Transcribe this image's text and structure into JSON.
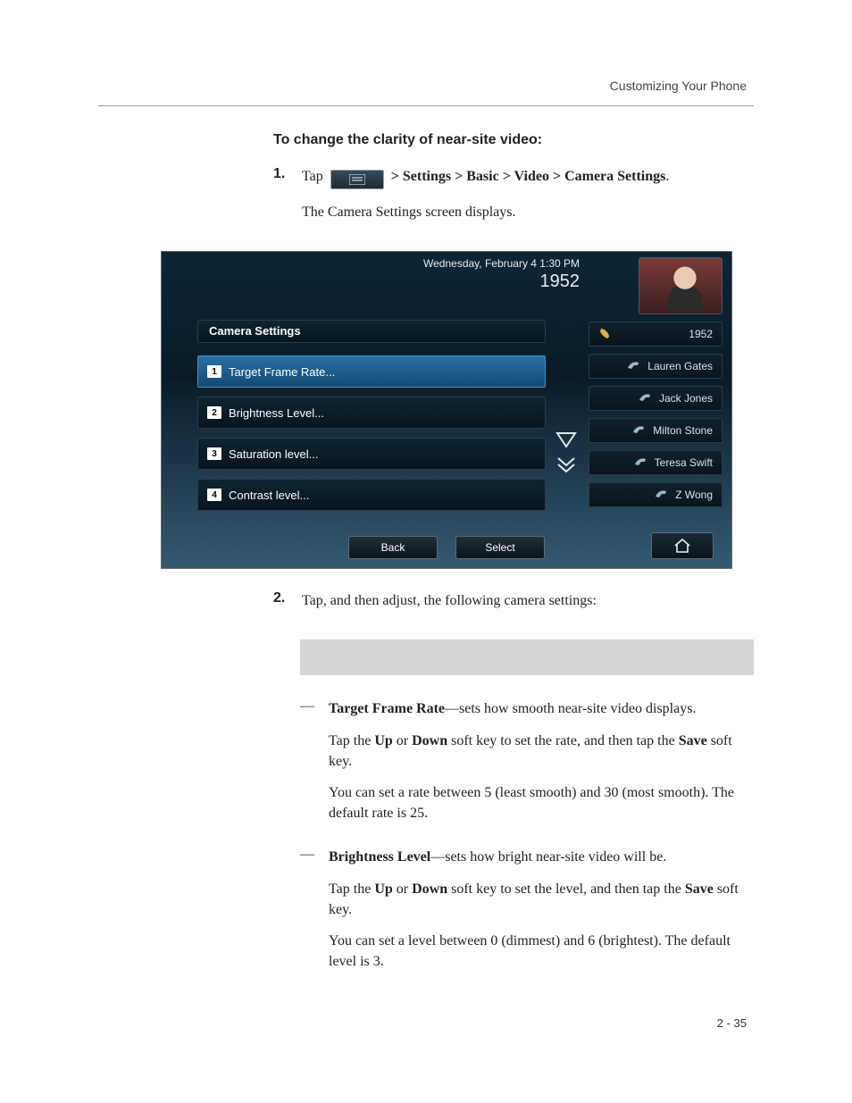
{
  "running_header": "Customizing Your Phone",
  "heading": "To change the clarity of near-site video:",
  "steps": {
    "s1": {
      "num": "1.",
      "lead": "Tap",
      "trail_prefix": " > ",
      "path1": "Settings",
      "path2": "Basic",
      "path3": "Video",
      "path4": "Camera Settings",
      "follow": "The Camera Settings screen displays."
    },
    "s2": {
      "num": "2.",
      "text": "Tap, and then adjust, the following camera settings:"
    }
  },
  "device": {
    "date": "Wednesday, February 4  1:30 PM",
    "extension": "1952",
    "title": "Camera Settings",
    "items": [
      {
        "n": "1",
        "label": "Target Frame Rate..."
      },
      {
        "n": "2",
        "label": "Brightness Level..."
      },
      {
        "n": "3",
        "label": "Saturation level..."
      },
      {
        "n": "4",
        "label": "Contrast level..."
      }
    ],
    "side": {
      "ext": "1952",
      "contacts": [
        "Lauren Gates",
        "Jack Jones",
        "Milton Stone",
        "Teresa Swift",
        "Z Wong"
      ]
    },
    "softkeys": {
      "back": "Back",
      "select": "Select"
    }
  },
  "bullets": {
    "b1": {
      "title": "Target Frame Rate",
      "desc": "—sets how smooth near-site video displays.",
      "p1a": "Tap the ",
      "k1": "Up",
      "p1b": " or ",
      "k2": "Down",
      "p1c": " soft key to set the rate, and then tap the ",
      "k3": "Save",
      "p1d": " soft key.",
      "p2": "You can set a rate between 5 (least smooth) and 30 (most smooth). The default rate is 25."
    },
    "b2": {
      "title": "Brightness Level",
      "desc": "—sets how bright near-site video will be.",
      "p1a": "Tap the ",
      "k1": "Up",
      "p1b": " or ",
      "k2": "Down",
      "p1c": " soft key to set the level, and then tap the ",
      "k3": "Save",
      "p1d": " soft key.",
      "p2": "You can set a level between 0 (dimmest) and 6 (brightest). The default level is 3."
    }
  },
  "page_number": "2 - 35"
}
